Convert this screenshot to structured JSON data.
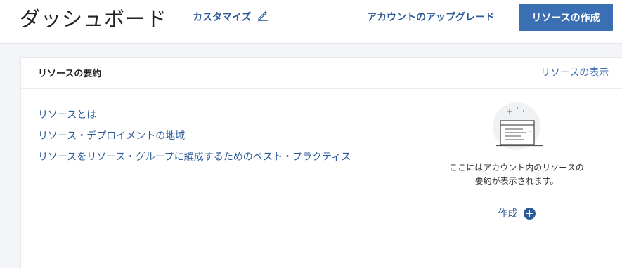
{
  "header": {
    "title": "ダッシュボード",
    "customize_label": "カスタマイズ",
    "upgrade_label": "アカウントのアップグレード",
    "create_resource_label": "リソースの作成"
  },
  "summary_card": {
    "title": "リソースの要約",
    "view_link": "リソースの表示",
    "links": [
      "リソースとは",
      "リソース・デプロイメントの地域",
      "リソースをリソース・グループに編成するためのベスト・プラクティス"
    ],
    "empty_state": {
      "message": "ここにはアカウント内のリソースの\n要約が表示されます。",
      "create_label": "作成",
      "icons": [
        "window-list-illustration-icon",
        "plus-circle-icon"
      ]
    }
  },
  "colors": {
    "accent": "#3a6fb4",
    "link": "#2d5b99",
    "background": "#f4f5f8"
  }
}
